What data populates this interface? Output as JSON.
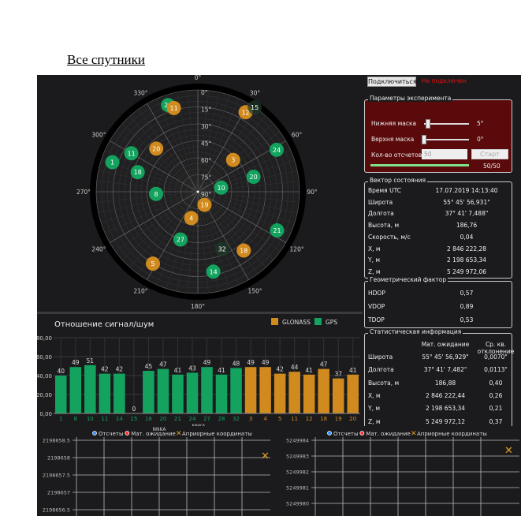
{
  "page_title": "Все спутники",
  "colors": {
    "gps": "#13a35f",
    "glonass": "#d08a1e",
    "panel_red": "#5b0a0b",
    "status_red": "#e01010"
  },
  "sky": {
    "azimuth_labels": [
      "0°",
      "30°",
      "60°",
      "90°",
      "120°",
      "150°",
      "180°",
      "210°",
      "240°",
      "270°",
      "300°",
      "330°"
    ],
    "elevation_labels": [
      "0°",
      "15°",
      "30°",
      "45°",
      "60°",
      "75°",
      "90°"
    ],
    "satellites": [
      {
        "id": "28",
        "system": "gps",
        "az": 341,
        "el": 9
      },
      {
        "id": "11",
        "system": "glonass",
        "az": 344,
        "el": 13
      },
      {
        "id": "12",
        "system": "glonass",
        "az": 31,
        "el": 8
      },
      {
        "id": "15",
        "system": "gps",
        "az": 34,
        "el": 0,
        "dim": true
      },
      {
        "id": "24",
        "system": "gps",
        "az": 62,
        "el": 11
      },
      {
        "id": "20",
        "system": "glonass",
        "az": 316,
        "el": 37
      },
      {
        "id": "11",
        "system": "gps",
        "az": 300,
        "el": 22
      },
      {
        "id": "1",
        "system": "gps",
        "az": 289,
        "el": 10
      },
      {
        "id": "18",
        "system": "gps",
        "az": 288,
        "el": 34
      },
      {
        "id": "3",
        "system": "glonass",
        "az": 48,
        "el": 48
      },
      {
        "id": "20",
        "system": "gps",
        "az": 75,
        "el": 39
      },
      {
        "id": "10",
        "system": "gps",
        "az": 80,
        "el": 69
      },
      {
        "id": "8",
        "system": "gps",
        "az": 267,
        "el": 53
      },
      {
        "id": "19",
        "system": "glonass",
        "az": 153,
        "el": 77
      },
      {
        "id": "4",
        "system": "glonass",
        "az": 194,
        "el": 66
      },
      {
        "id": "21",
        "system": "gps",
        "az": 116,
        "el": 12
      },
      {
        "id": "27",
        "system": "gps",
        "az": 200,
        "el": 45
      },
      {
        "id": "32",
        "system": "gps",
        "az": 157,
        "el": 35,
        "dim": true
      },
      {
        "id": "18",
        "system": "glonass",
        "az": 142,
        "el": 24
      },
      {
        "id": "5",
        "system": "glonass",
        "az": 212,
        "el": 15
      },
      {
        "id": "14",
        "system": "gps",
        "az": 169,
        "el": 18
      }
    ]
  },
  "chart_data": {
    "type": "bar",
    "title": "Отношение сигнал/шум",
    "xlabel": "NNKA",
    "ylabel": "",
    "ylim": [
      0,
      80
    ],
    "yticks": [
      "0,00",
      "20,00",
      "40,00",
      "60,00",
      "80,00"
    ],
    "legend": [
      {
        "name": "GLONASS",
        "color": "#d08a1e"
      },
      {
        "name": "GPS",
        "color": "#13a35f"
      }
    ],
    "categories": [
      "1",
      "8",
      "10",
      "11",
      "14",
      "15",
      "18",
      "20",
      "21",
      "24",
      "27",
      "28",
      "32",
      "3",
      "4",
      "5",
      "11",
      "12",
      "18",
      "19",
      "20"
    ],
    "systems": [
      "gps",
      "gps",
      "gps",
      "gps",
      "gps",
      "gps",
      "gps",
      "gps",
      "gps",
      "gps",
      "gps",
      "gps",
      "gps",
      "glonass",
      "glonass",
      "glonass",
      "glonass",
      "glonass",
      "glonass",
      "glonass",
      "glonass"
    ],
    "values": [
      40,
      49,
      51,
      42,
      42,
      0,
      45,
      47,
      41,
      43,
      49,
      41,
      48,
      49,
      49,
      42,
      44,
      41,
      47,
      37,
      41
    ]
  },
  "controls": {
    "connect_label": "Подключиться",
    "status": "Не подключен"
  },
  "experiment": {
    "title": "Параметры эксперимента",
    "lower_mask_label": "Нижняя маска",
    "lower_mask_value": "5°",
    "lower_mask": 5,
    "upper_mask_label": "Верхня маска",
    "upper_mask_value": "0°",
    "upper_mask": 0,
    "count_label": "Кол-во отсчетов",
    "count_value": "50",
    "start_label": "Старт",
    "progress_text": "50/50",
    "progress": 1.0
  },
  "state": {
    "title": "Вектор состояния",
    "rows": [
      {
        "label": "Время UTC",
        "value": "17.07.2019 14:13:40"
      },
      {
        "label": "Широта",
        "value": "55° 45' 56,931\""
      },
      {
        "label": "Долгота",
        "value": "37° 41' 7,488\""
      },
      {
        "label": "Высота, м",
        "value": "186,76"
      },
      {
        "label": "Скорость, м/с",
        "value": "0,04"
      },
      {
        "label": "X, м",
        "value": "2 846 222,28"
      },
      {
        "label": "Y, м",
        "value": "2 198 653,34"
      },
      {
        "label": "Z, м",
        "value": "5 249 972,06"
      }
    ]
  },
  "dop": {
    "title": "Геометрический фактор",
    "rows": [
      {
        "label": "HDOP",
        "value": "0,57"
      },
      {
        "label": "VDOP",
        "value": "0,89"
      },
      {
        "label": "TDOP",
        "value": "0,53"
      }
    ]
  },
  "stats": {
    "title": "Статистическая информация",
    "col_mean": "Мат. ожидание",
    "col_std": "Ср. кв. отклонение",
    "rows": [
      {
        "label": "Широта",
        "mean": "55° 45' 56,929\"",
        "std": "0,0070\""
      },
      {
        "label": "Долгота",
        "mean": "37° 41' 7,482\"",
        "std": "0,0113\""
      },
      {
        "label": "Высота, м",
        "mean": "186,88",
        "std": "0,40"
      },
      {
        "label": "X, м",
        "mean": "2 846 222,44",
        "std": "0,26"
      },
      {
        "label": "Y, м",
        "mean": "2 198 653,34",
        "std": "0,21"
      },
      {
        "label": "Z, м",
        "mean": "5 249 972,12",
        "std": "0,37"
      }
    ]
  },
  "plots": [
    {
      "legend": [
        "Отсчеты",
        "Мат. ожидание",
        "Априорные координаты"
      ],
      "yticks": [
        "2198658.5",
        "2198658",
        "2198657.5",
        "2198657",
        "2198656.5"
      ]
    },
    {
      "legend": [
        "Отсчеты",
        "Мат. ожидание",
        "Априорные координаты"
      ],
      "yticks": [
        "5249984",
        "5249983",
        "5249982",
        "5249981",
        "5249980"
      ]
    }
  ]
}
